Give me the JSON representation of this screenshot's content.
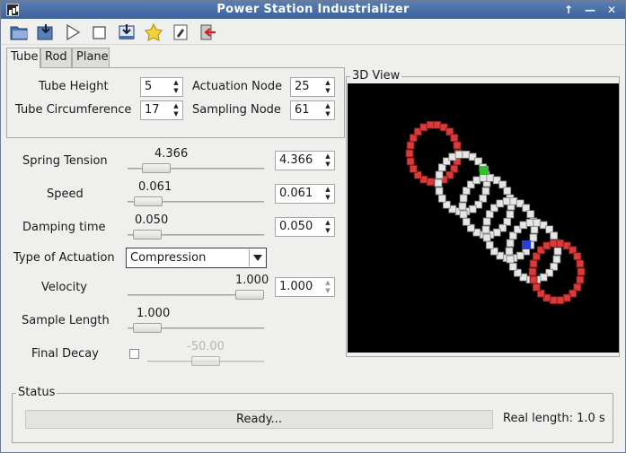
{
  "window": {
    "title": "Power Station Industrializer"
  },
  "title_buttons": [
    "↑",
    "—",
    "✕"
  ],
  "toolbar": [
    "open-icon",
    "save-icon",
    "play-icon",
    "stop-icon",
    "export-icon",
    "star-icon",
    "edit-icon",
    "exit-icon"
  ],
  "tabs": [
    {
      "label": "Tube",
      "active": true
    },
    {
      "label": "Rod",
      "active": false
    },
    {
      "label": "Plane",
      "active": false
    }
  ],
  "tube": {
    "height_label": "Tube Height",
    "height_value": "5",
    "circ_label": "Tube Circumference",
    "circ_value": "17",
    "actuation_label": "Actuation Node",
    "actuation_value": "25",
    "sampling_label": "Sampling Node",
    "sampling_value": "61"
  },
  "params": {
    "spring_tension": {
      "label": "Spring Tension",
      "display": "4.366",
      "spin": "4.366",
      "position": 0.13
    },
    "speed": {
      "label": "Speed",
      "display": "0.061",
      "spin": "0.061",
      "position": 0.06
    },
    "damping_time": {
      "label": "Damping time",
      "display": "0.050",
      "spin": "0.050",
      "position": 0.05
    },
    "actuation_type": {
      "label": "Type of Actuation",
      "value": "Compression"
    },
    "velocity": {
      "label": "Velocity",
      "display": "1.000",
      "spin": "1.000",
      "position": 1.0
    },
    "sample_length": {
      "label": "Sample Length",
      "display": "1.000",
      "position": 0.05
    },
    "final_decay": {
      "label": "Final Decay",
      "display": "-50.00",
      "position": 0.5,
      "checked": false
    }
  },
  "view3d": {
    "label": "3D View"
  },
  "status": {
    "label": "Status",
    "message": "Ready...",
    "real_length": "Real length: 1.0 s"
  }
}
